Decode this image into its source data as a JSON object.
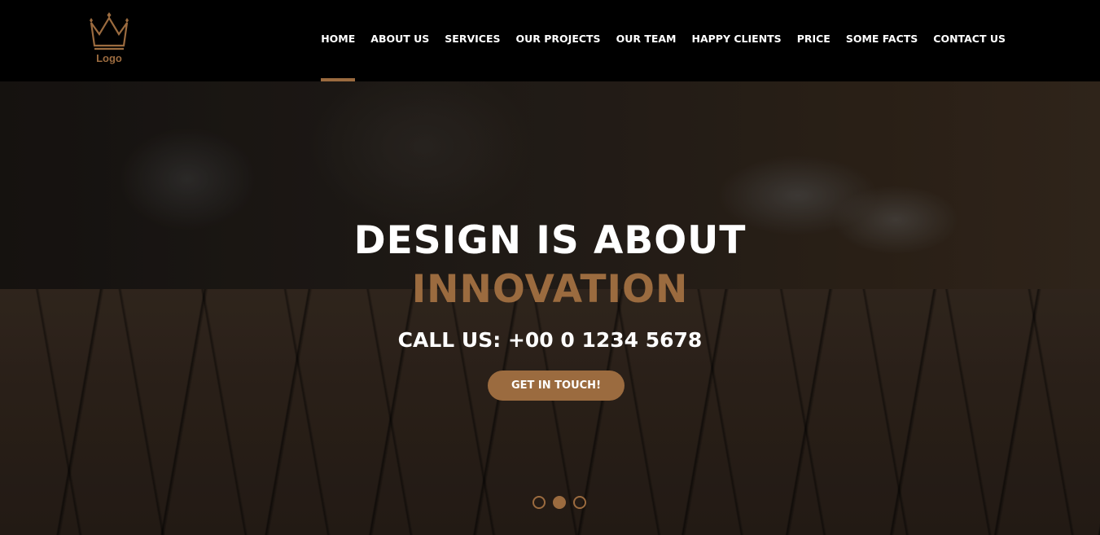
{
  "logo": {
    "text": "Logo"
  },
  "nav": {
    "items": [
      {
        "label": "HOME",
        "active": true
      },
      {
        "label": "ABOUT US",
        "active": false
      },
      {
        "label": "SERVICES",
        "active": false
      },
      {
        "label": "OUR PROJECTS",
        "active": false
      },
      {
        "label": "OUR TEAM",
        "active": false
      },
      {
        "label": "HAPPY CLIENTS",
        "active": false
      },
      {
        "label": "PRICE",
        "active": false
      },
      {
        "label": "SOME FACTS",
        "active": false
      },
      {
        "label": "CONTACT US",
        "active": false
      }
    ]
  },
  "hero": {
    "headline": "DESIGN IS ABOUT",
    "headline_accent": "INNOVATION",
    "phone": "CALL US: +00 0 1234 5678",
    "cta_label": "GET IN TOUCH!",
    "slides": {
      "count": 3,
      "active_index": 1
    }
  },
  "colors": {
    "accent": "#9b6b3f",
    "topbar": "#000000",
    "text": "#ffffff"
  },
  "icons": {
    "logo": "crown-icon"
  }
}
